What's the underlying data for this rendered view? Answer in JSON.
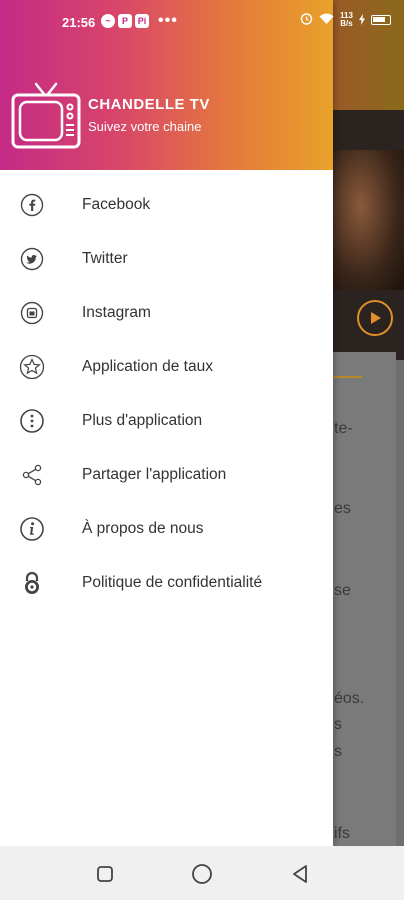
{
  "status_bar": {
    "time": "21:56",
    "notification_icons": [
      "messenger-icon",
      "p-icon",
      "pi-icon"
    ],
    "more": "•••",
    "net_speed_top": "113",
    "net_speed_bottom": "B/s"
  },
  "brand": {
    "title": "CHANDELLE TV",
    "subtitle": "Suivez votre chaine",
    "logo_icon": "tv-icon",
    "gradient": [
      "#c42a86",
      "#e57a3c",
      "#e8a22a"
    ]
  },
  "menu": {
    "items": [
      {
        "label": "Facebook",
        "icon": "facebook-icon"
      },
      {
        "label": "Twitter",
        "icon": "twitter-icon"
      },
      {
        "label": "Instagram",
        "icon": "instagram-icon"
      },
      {
        "label": "Application de taux",
        "icon": "star-icon"
      },
      {
        "label": "Plus d'application",
        "icon": "more-vertical-icon"
      },
      {
        "label": "Partager l'application",
        "icon": "share-icon"
      },
      {
        "label": "À propos de nous",
        "icon": "info-icon"
      },
      {
        "label": "Politique de confidentialité",
        "icon": "lock-icon"
      }
    ]
  },
  "background_fragments": [
    "te-",
    "es",
    "se",
    "éos.",
    "s",
    "s",
    "ifs"
  ],
  "nav_bar": {
    "buttons": [
      "recents-button",
      "home-button",
      "back-button"
    ]
  }
}
